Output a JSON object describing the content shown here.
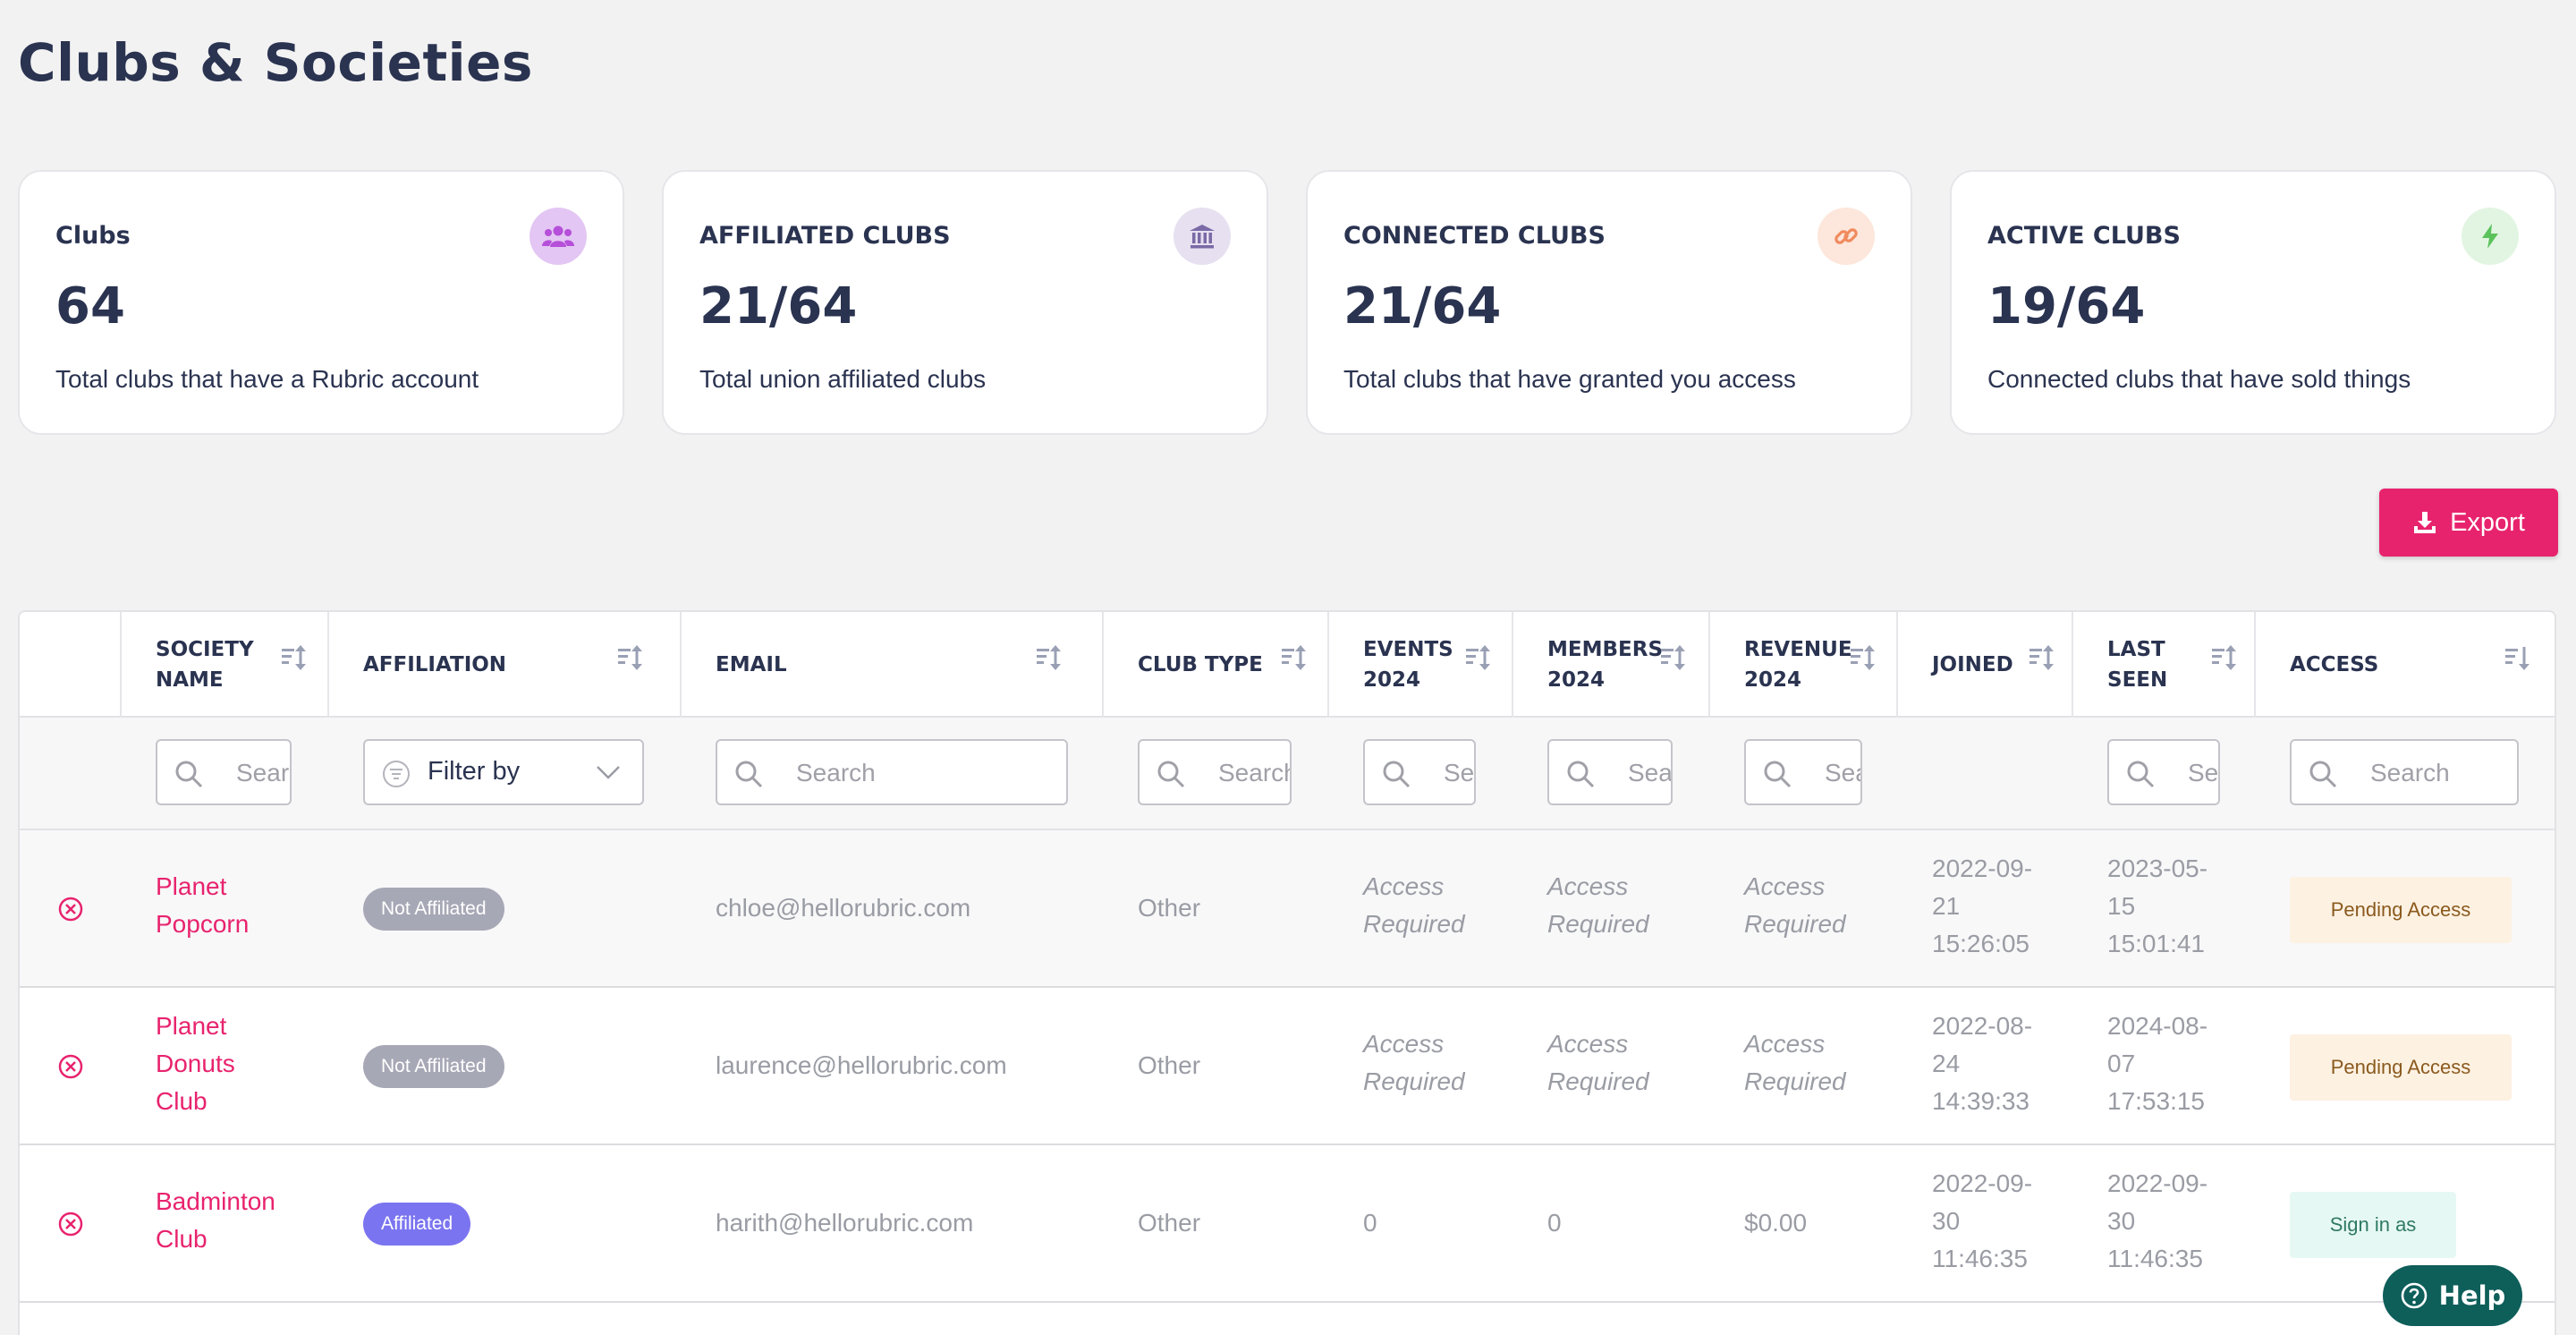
{
  "page": {
    "title": "Clubs & Societies"
  },
  "cards": [
    {
      "label": "Clubs",
      "value": "64",
      "desc": "Total clubs that have a Rubric account",
      "icon": "people-group-icon",
      "icon_bg": "#e3c6f3",
      "icon_color": "#b64fd9"
    },
    {
      "label": "AFFILIATED CLUBS",
      "value": "21/64",
      "desc": "Total union affiliated clubs",
      "icon": "institution-icon",
      "icon_bg": "#e6e0f0",
      "icon_color": "#7a6aa6"
    },
    {
      "label": "CONNECTED CLUBS",
      "value": "21/64",
      "desc": "Total clubs that have granted you access",
      "icon": "link-icon",
      "icon_bg": "#fde6db",
      "icon_color": "#f08a5d"
    },
    {
      "label": "ACTIVE CLUBS",
      "value": "19/64",
      "desc": "Connected clubs that have sold things",
      "icon": "bolt-icon",
      "icon_bg": "#e2f5e2",
      "icon_color": "#5cc25c"
    }
  ],
  "toolbar": {
    "export_label": "Export"
  },
  "table": {
    "columns": [
      {
        "key": "society_name",
        "label_line1": "SOCIETY",
        "label_line2": "NAME"
      },
      {
        "key": "affiliation",
        "label_line1": "AFFILIATION",
        "label_line2": ""
      },
      {
        "key": "email",
        "label_line1": "EMAIL",
        "label_line2": ""
      },
      {
        "key": "club_type",
        "label_line1": "CLUB TYPE",
        "label_line2": ""
      },
      {
        "key": "events",
        "label_line1": "EVENTS",
        "label_line2": "2024"
      },
      {
        "key": "members",
        "label_line1": "MEMBERS",
        "label_line2": "2024"
      },
      {
        "key": "revenue",
        "label_line1": "REVENUE",
        "label_line2": "2024"
      },
      {
        "key": "joined",
        "label_line1": "JOINED",
        "label_line2": ""
      },
      {
        "key": "last_seen",
        "label_line1": "LAST",
        "label_line2": "SEEN"
      },
      {
        "key": "access",
        "label_line1": "ACCESS",
        "label_line2": ""
      }
    ],
    "filters": {
      "search_placeholder": "Search",
      "affiliation_placeholder": "Filter by"
    },
    "rows": [
      {
        "name_line1": "Planet",
        "name_line2": "Popcorn",
        "name_line3": "",
        "affiliation": "Not Affiliated",
        "email": "chloe@hellorubric.com",
        "club_type": "Other",
        "events_line1": "Access",
        "events_line2": "Required",
        "members_line1": "Access",
        "members_line2": "Required",
        "revenue_line1": "Access",
        "revenue_line2": "Required",
        "joined_line1": "2022-09-",
        "joined_line2": "21",
        "joined_line3": "15:26:05",
        "last_line1": "2023-05-",
        "last_line2": "15",
        "last_line3": "15:01:41",
        "access": "Pending Access"
      },
      {
        "name_line1": "Planet",
        "name_line2": "Donuts",
        "name_line3": "Club",
        "affiliation": "Not Affiliated",
        "email": "laurence@hellorubric.com",
        "club_type": "Other",
        "events_line1": "Access",
        "events_line2": "Required",
        "members_line1": "Access",
        "members_line2": "Required",
        "revenue_line1": "Access",
        "revenue_line2": "Required",
        "joined_line1": "2022-08-",
        "joined_line2": "24",
        "joined_line3": "14:39:33",
        "last_line1": "2024-08-",
        "last_line2": "07",
        "last_line3": "17:53:15",
        "access": "Pending Access"
      },
      {
        "name_line1": "Badminton",
        "name_line2": "Club",
        "name_line3": "",
        "affiliation": "Affiliated",
        "email": "harith@hellorubric.com",
        "club_type": "Other",
        "events": "0",
        "members": "0",
        "revenue": "$0.00",
        "joined_line1": "2022-09-",
        "joined_line2": "30",
        "joined_line3": "11:46:35",
        "last_line1": "2022-09-",
        "last_line2": "30",
        "last_line3": "11:46:35",
        "access": "Sign in as"
      }
    ]
  },
  "help": {
    "label": "Help"
  },
  "colors": {
    "accent": "#e8236e",
    "not_affiliated": "#a7a8b6",
    "affiliated": "#7b74f0",
    "pending_bg": "#fdf1e2",
    "pending_text": "#8a5a1e",
    "signin_bg": "#e6f8f3",
    "signin_text": "#2f7a62",
    "help_bg": "#0e5e5a"
  }
}
